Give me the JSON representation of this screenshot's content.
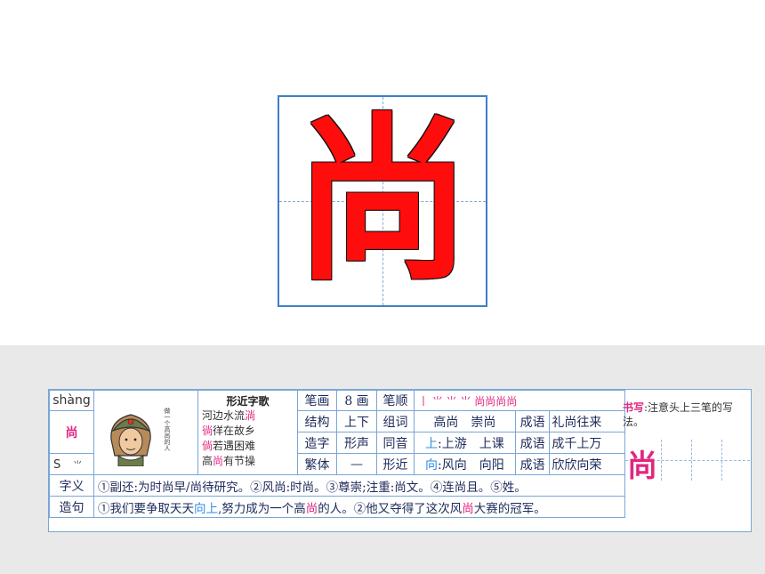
{
  "big_character": "尚",
  "card": {
    "pinyin": "shàng",
    "character": "尚",
    "radical_code": "S",
    "radical": "⺌",
    "song": {
      "title": "形近字歌",
      "lines": [
        [
          {
            "t": "河边水流",
            "c": ""
          },
          {
            "t": "淌",
            "c": "pink"
          }
        ],
        [
          {
            "t": "徜",
            "c": "pink"
          },
          {
            "t": "徉在故乡",
            "c": ""
          }
        ],
        [
          {
            "t": "倘",
            "c": "pink"
          },
          {
            "t": "若遇困难",
            "c": ""
          }
        ],
        [
          {
            "t": "高",
            "c": ""
          },
          {
            "t": "尚",
            "c": "pink"
          },
          {
            "t": "有节操",
            "c": ""
          }
        ]
      ]
    },
    "avatar_caption": "做一个高尚的人",
    "rows": [
      {
        "l1": "笔画",
        "v1": "8 画",
        "l2": "笔顺",
        "v2": "丨 ⺌ ⺌ ⺌ 尚尚尚尚",
        "l3": "",
        "v3": ""
      },
      {
        "l1": "结构",
        "v1": "上下",
        "l2": "组词",
        "v2": "高尚　崇尚",
        "l3": "成语",
        "v3": "礼尚往来"
      },
      {
        "l1": "造字",
        "v1": "形声",
        "l2": "同音",
        "v2_prefix": "上",
        "v2": ":上游　上课",
        "l3": "成语",
        "v3": "成千上万"
      },
      {
        "l1": "繁体",
        "v1": "—",
        "l2": "形近",
        "v2_prefix": "向",
        "v2": ":风向　向阳",
        "l3": "成语",
        "v3": "欣欣向荣"
      }
    ],
    "writing_note": {
      "heading": "书写",
      "text": ":注意头上三笔的写法。"
    },
    "writing_char": "尚",
    "meaning_label": "字义",
    "meaning_text": "①副还:为时尚早/尚待研究。②风尚:时尚。③尊崇;注重:尚文。④连尚且。⑤姓。",
    "sentence_label": "造句",
    "sentence_parts": [
      {
        "t": "①我们要争取天天",
        "c": ""
      },
      {
        "t": "向上",
        "c": "blue"
      },
      {
        "t": ",努力成为一个高",
        "c": ""
      },
      {
        "t": "尚",
        "c": "pink"
      },
      {
        "t": "的人。②他又夺得了这次风",
        "c": ""
      },
      {
        "t": "尚",
        "c": "pink"
      },
      {
        "t": "大赛的冠军。",
        "c": ""
      }
    ]
  }
}
